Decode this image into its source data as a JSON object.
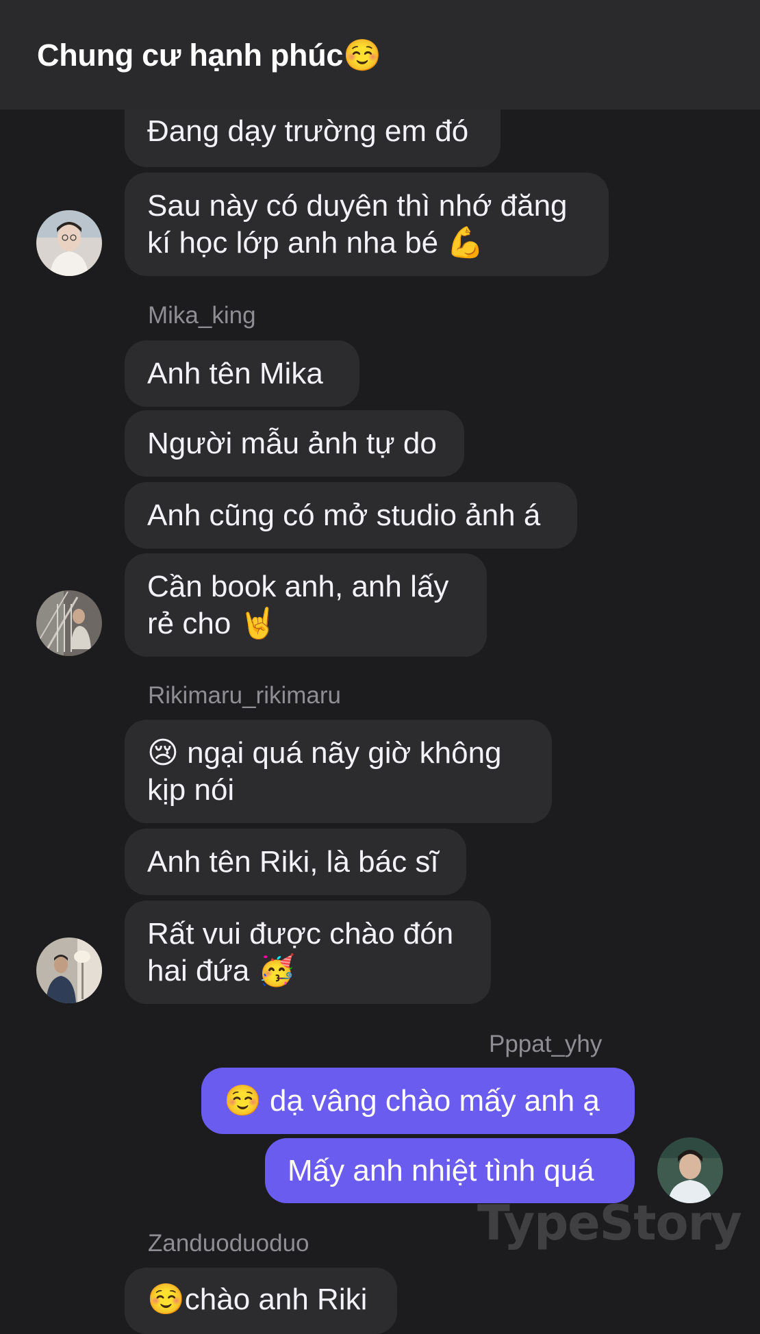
{
  "header": {
    "title": "Chung cư hạnh phúc☺️"
  },
  "messages": {
    "m1": "Đang dạy trường em đó",
    "m2": "Sau này có duyên thì nhớ đăng\nkí học lớp anh nha bé 💪",
    "mika_name": "Mika_king",
    "m3": "Anh tên Mika",
    "m4": "Người mẫu ảnh tự do",
    "m5": "Anh cũng có mở studio ảnh á",
    "m6": "Cần book anh, anh lấy\nrẻ cho 🤘",
    "riki_name": "Rikimaru_rikimaru",
    "m7": "😢 ngại quá nãy giờ không\nkịp nói",
    "m8": "Anh tên Riki, là bác sĩ",
    "m9": "Rất vui được chào đón\nhai đứa 🥳",
    "pat_name": "Pppat_yhy",
    "m10": "☺️ dạ vâng chào mấy anh ạ",
    "m11": "Mấy anh nhiệt tình quá",
    "zan_name": "Zanduoduoduo",
    "m12": "☺️chào anh Riki"
  },
  "watermark": "TypeStory",
  "colors": {
    "background": "#1c1c1e",
    "header": "#2a2a2c",
    "bubble_other": "#2c2c2e",
    "bubble_mine": "#6b5cf0",
    "sender_name": "#8e8e93"
  }
}
